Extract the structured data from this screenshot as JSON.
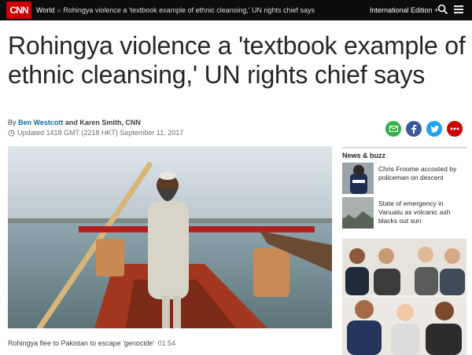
{
  "nav": {
    "logo": "CNN",
    "section": "World",
    "separator": "»",
    "article_title": "Rohingya violence a 'textbook example of ethnic cleansing,' UN rights chief says",
    "edition": "International Edition +",
    "icons": [
      "search-icon",
      "menu-icon"
    ]
  },
  "article": {
    "headline": "Rohingya violence a 'textbook example of ethnic cleansing,' UN rights chief says",
    "byline_prefix": "By",
    "author1": "Ben Westcott",
    "byline_and": "and Karen Smith, CNN",
    "updated": "Updated 1418 GMT (2218 HKT) September 11, 2017"
  },
  "share": {
    "icons": [
      "email-icon",
      "facebook-icon",
      "twitter-icon",
      "more-icon"
    ],
    "colors": {
      "email": "#34b34a",
      "facebook": "#3b5998",
      "twitter": "#1da1f2",
      "more": "#cc0000"
    }
  },
  "video": {
    "caption": "Rohingya flee to Pakistan to escape 'genocide'",
    "duration": "01:54"
  },
  "sidebar": {
    "heading": "News & buzz",
    "items": [
      {
        "text": "Chris Froome accosted by policeman on descent"
      },
      {
        "text": "State of emergency in Vanuatu as volcanic ash blacks out sun"
      }
    ]
  },
  "colors": {
    "brand": "#cc0000",
    "nav_bg": "#0c0c0c",
    "link": "#0c6b9e"
  }
}
